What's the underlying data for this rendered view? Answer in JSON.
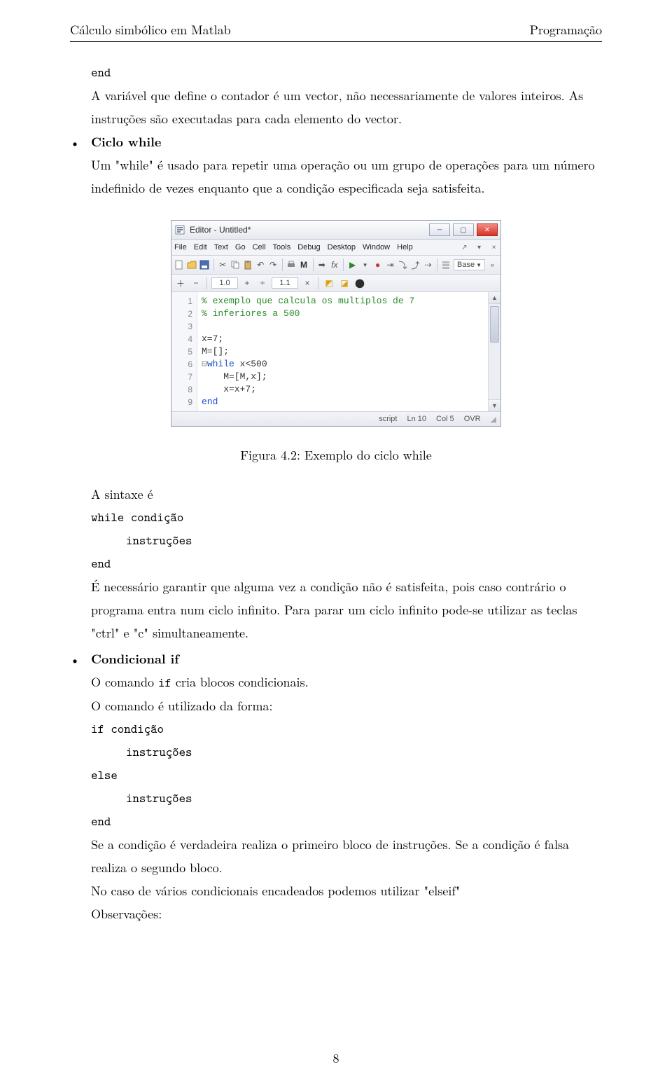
{
  "header": {
    "left": "Cálculo simbólico em Matlab",
    "right": "Programação"
  },
  "line_end1": "end",
  "para1a": "A variável que define o contador é um vector, não necessariamente de valores inteiros. As",
  "para1b": "instruções são executadas para cada elemento do vector.",
  "bullet1_title": "Ciclo while",
  "bullet1a": "Um \"while\" é usado para repetir uma operação ou um grupo de operações para um número",
  "bullet1b": "indefinido de vezes enquanto que a condição especificada seja satisfeita.",
  "caption": "Figura 4.2:   Exemplo do ciclo while",
  "syntax_intro": "A sintaxe é",
  "sy_while": "while condição",
  "sy_instr": "instruções",
  "sy_end": "end",
  "para2a": "É necessário garantir que alguma vez a condição não é satisfeita, pois caso contrário o",
  "para2b": "programa entra num ciclo infinito. Para parar um ciclo infinito pode-se utilizar as teclas",
  "para2c": "\"ctrl\" e \"c\" simultaneamente.",
  "bullet2_title": "Condicional if",
  "bullet2a_pre": "O comando ",
  "bullet2a_tt": "if",
  "bullet2a_post": " cria blocos condicionais.",
  "bullet2b": " O comando é utilizado da forma:",
  "if_line": "if condição",
  "else_line": "else",
  "end_line": "end",
  "para3a": "Se a condição é verdadeira realiza o primeiro bloco de instruções.  Se a condição é falsa",
  "para3b": "realiza o segundo bloco.",
  "para4": "No caso de vários condicionais encadeados podemos utilizar \"elseif\"",
  "para5": "Observações:",
  "pagenum": "8",
  "editor": {
    "title": "Editor - Untitled*",
    "menus": [
      "File",
      "Edit",
      "Text",
      "Go",
      "Cell",
      "Tools",
      "Debug",
      "Desktop",
      "Window",
      "Help"
    ],
    "base_label": "Base",
    "tool2": {
      "f1": "1.0",
      "f2": "1.1"
    },
    "lines": [
      "1",
      "2",
      "3",
      "4",
      "5",
      "6",
      "7",
      "8",
      "9"
    ],
    "code": {
      "l1": "% exemplo que calcula os multiplos de 7",
      "l2": "% inferiores a 500",
      "l3": "",
      "l4": "x=7;",
      "l5": "M=[];",
      "l6_kw": "while",
      "l6_rest": " x<500",
      "l7": "    M=[M,x];",
      "l8": "    x=x+7;",
      "l9_kw": "end"
    },
    "status": {
      "type": "script",
      "ln": "Ln  10",
      "col": "Col  5",
      "ovr": "OVR"
    }
  }
}
